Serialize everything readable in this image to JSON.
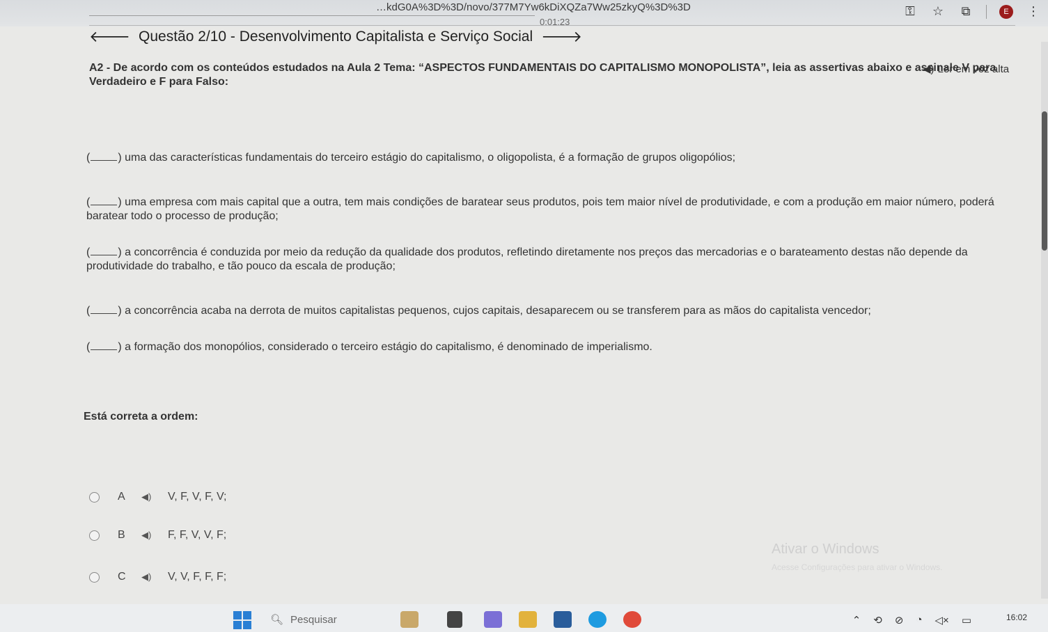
{
  "browser": {
    "url": "…kdG0A%3D%3D/novo/377M7Yw6kDiXQZa7Ww25zkyQ%3D%3D",
    "timer": "0:01:23"
  },
  "header": {
    "title": "Questão 2/10 - Desenvolvimento Capitalista e Serviço Social",
    "read_aloud": "Ler em voz alta"
  },
  "question": {
    "prompt": "A2 - De acordo com os conteúdos estudados na Aula 2 Tema: “ASPECTOS FUNDAMENTAIS DO CAPITALISMO MONOPOLISTA”, leia as assertivas abaixo e assinale V para Verdadeiro e F para Falso:",
    "items": [
      "uma das características fundamentais do terceiro estágio do capitalismo, o oligopolista, é a formação de grupos oligopólios;",
      "uma empresa com mais capital que a outra, tem mais condições de baratear seus produtos, pois tem maior nível de produtividade, e com a produção em maior número, poderá baratear todo o processo de produção;",
      "a concorrência é conduzida por meio da redução da qualidade dos produtos, refletindo diretamente nos preços das mercadorias e o barateamento destas não depende da produtividade do trabalho, e tão pouco da escala de produção;",
      "a concorrência acaba na derrota de muitos capitalistas pequenos, cujos capitais, desaparecem ou se transferem para as mãos do capitalista vencedor;",
      "a formação dos monopólios, considerado o terceiro estágio do capitalismo, é denominado de imperialismo."
    ],
    "answer_label": "Está correta a ordem:",
    "options": [
      {
        "letter": "A",
        "text": "V, F, V, F, V;"
      },
      {
        "letter": "B",
        "text": "F, F, V, V, F;"
      },
      {
        "letter": "C",
        "text": "V, V, F, F, F;"
      }
    ]
  },
  "os": {
    "watermark": "Ativar o Windows",
    "watermark_sub": "Acesse Configurações para ativar o Windows.",
    "search_placeholder": "Pesquisar",
    "time": "16:02"
  }
}
